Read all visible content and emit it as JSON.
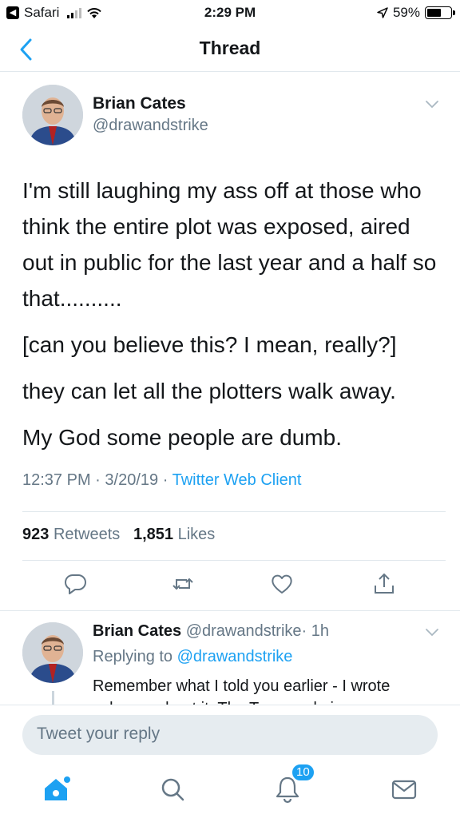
{
  "status_bar": {
    "back_app": "Safari",
    "time": "2:29 PM",
    "battery": "59%",
    "battery_level": 0.59
  },
  "nav": {
    "title": "Thread"
  },
  "tweet": {
    "author_name": "Brian Cates",
    "author_handle": "@drawandstrike",
    "paragraphs": [
      "I'm still laughing my ass off at those who think the entire plot was exposed, aired out in public for the last year and a half so that..........",
      "[can you believe this? I mean, really?]",
      "they can let all the plotters walk away.",
      "My God some people are dumb."
    ],
    "time": "12:37 PM",
    "date": "3/20/19",
    "separator": "·",
    "client": "Twitter Web Client",
    "retweets_count": "923",
    "retweets_label": "Retweets",
    "likes_count": "1,851",
    "likes_label": "Likes"
  },
  "reply": {
    "author_name": "Brian Cates",
    "author_handle": "@drawandstrike",
    "age": "· 1h",
    "replying_label": "Replying to",
    "replying_to": "@drawandstrike",
    "text": "Remember what I told you earlier - I wrote columns about it. The Trump admin"
  },
  "compose": {
    "placeholder": "Tweet your reply"
  },
  "tabs": {
    "notifications_badge": "10"
  },
  "colors": {
    "accent": "#1da1f2",
    "secondary_text": "#657786",
    "divider": "#e1e8ed"
  }
}
